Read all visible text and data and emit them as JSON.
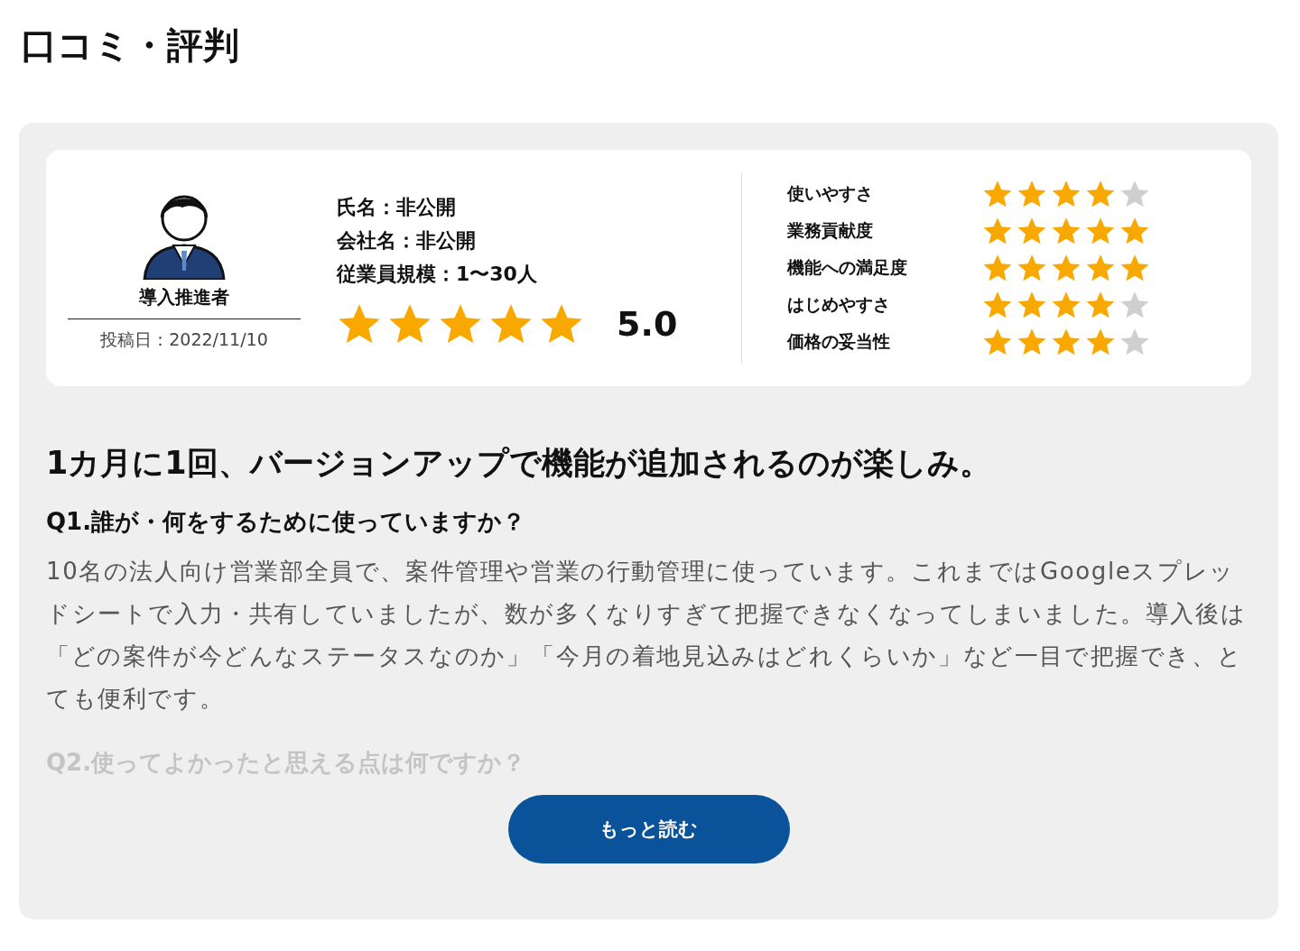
{
  "title": "口コミ・評判",
  "review": {
    "role": "導入推進者",
    "posted": "投稿日：2022/11/10",
    "info": [
      "氏名：非公開",
      "会社名：非公開",
      "従業員規模：1〜30人"
    ],
    "overall": {
      "stars": 5,
      "score": "5.0"
    },
    "ratings": [
      {
        "label": "使いやすさ",
        "stars": 4
      },
      {
        "label": "業務貢献度",
        "stars": 5
      },
      {
        "label": "機能への満足度",
        "stars": 5
      },
      {
        "label": "はじめやすさ",
        "stars": 4
      },
      {
        "label": "価格の妥当性",
        "stars": 4
      }
    ],
    "headline": "1カ月に1回、バージョンアップで機能が追加されるのが楽しみ。",
    "questions": [
      {
        "question": "Q1.誰が・何をするために使っていますか？",
        "answer": "10名の法人向け営業部全員で、案件管理や営業の行動管理に使っています。これまではGoogleスプレッドシートで入力・共有していましたが、数が多くなりすぎて把握できなくなってしまいました。導入後は「どの案件が今どんなステータスなのか」「今月の着地見込みはどれくらいか」など一目で把握でき、とても便利です。",
        "faded": false
      },
      {
        "question": "Q2.使ってよかったと思える点は何ですか？",
        "faded": true
      }
    ],
    "more_button": "もっと読む"
  }
}
